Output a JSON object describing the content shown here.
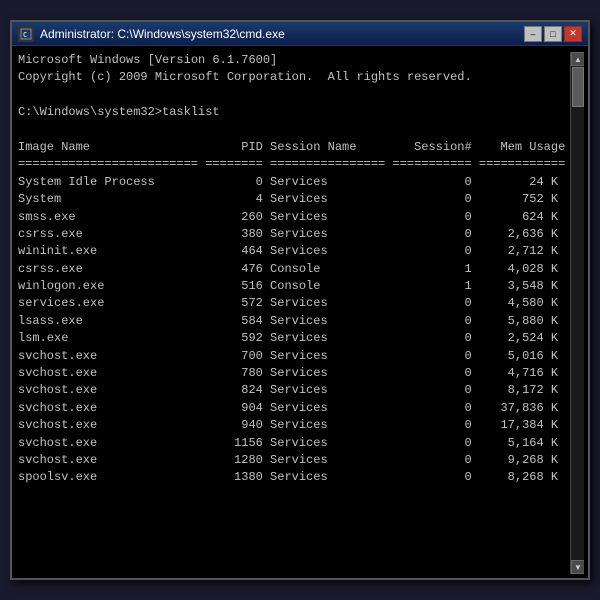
{
  "window": {
    "title": "Administrator: C:\\Windows\\system32\\cmd.exe",
    "icon": "cmd-icon"
  },
  "titlebar_buttons": {
    "minimize": "–",
    "maximize": "□",
    "close": "✕"
  },
  "console": {
    "lines": [
      "Microsoft Windows [Version 6.1.7600]",
      "Copyright (c) 2009 Microsoft Corporation.  All rights reserved.",
      "",
      "C:\\Windows\\system32>tasklist",
      "",
      "Image Name                     PID Session Name        Session#    Mem Usage",
      "========================= ======== ================ =========== ============",
      "System Idle Process              0 Services                   0        24 K",
      "System                           4 Services                   0       752 K",
      "smss.exe                       260 Services                   0       624 K",
      "csrss.exe                      380 Services                   0     2,636 K",
      "wininit.exe                    464 Services                   0     2,712 K",
      "csrss.exe                      476 Console                    1     4,028 K",
      "winlogon.exe                   516 Console                    1     3,548 K",
      "services.exe                   572 Services                   0     4,580 K",
      "lsass.exe                      584 Services                   0     5,880 K",
      "lsm.exe                        592 Services                   0     2,524 K",
      "svchost.exe                    700 Services                   0     5,016 K",
      "svchost.exe                    780 Services                   0     4,716 K",
      "svchost.exe                    824 Services                   0     8,172 K",
      "svchost.exe                    904 Services                   0    37,836 K",
      "svchost.exe                    940 Services                   0    17,384 K",
      "svchost.exe                   1156 Services                   0     5,164 K",
      "svchost.exe                   1280 Services                   0     9,268 K",
      "spoolsv.exe                   1380 Services                   0     8,268 K"
    ]
  }
}
